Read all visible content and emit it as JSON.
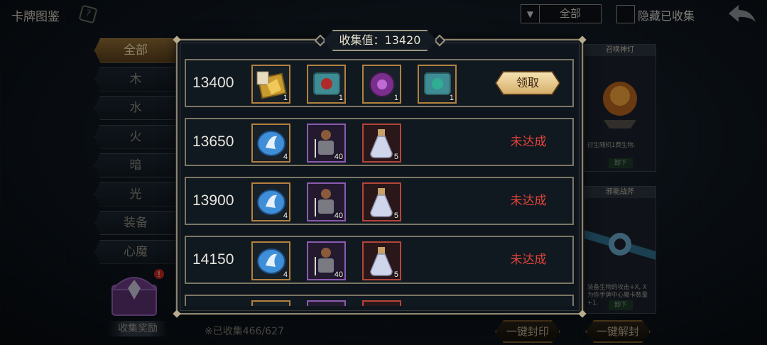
{
  "header": {
    "title": "卡牌图鉴",
    "filter_value": "全部",
    "hide_collected_label": "隐藏已收集"
  },
  "sidebar": {
    "categories": [
      "全部",
      "木",
      "水",
      "火",
      "暗",
      "光",
      "装备",
      "心魔"
    ],
    "collect_reward_label": "收集奖励"
  },
  "footer": {
    "collected_text": "※已收集466/627",
    "seal_all_label": "一键封印",
    "unseal_all_label": "一键解封"
  },
  "side_cards": [
    {
      "title": "召唤神灯",
      "text": "衍生随机1费生物.",
      "equip_label": "卸下"
    },
    {
      "title": "邪能战斧",
      "text": "装备生物的攻击+X, X为你手牌中心魔卡数量+1.",
      "equip_label": "卸下"
    }
  ],
  "modal": {
    "title": "收集值：13420",
    "claim_label": "领取",
    "not_achieved_label": "未达成",
    "milestones": [
      {
        "value": "13400",
        "status": "claimable",
        "rewards": [
          {
            "icon": "golden-card-pack-icon",
            "qty": "1"
          },
          {
            "icon": "red-rune-scroll-icon",
            "qty": "1"
          },
          {
            "icon": "purple-rune-orb-icon",
            "qty": "1"
          },
          {
            "icon": "teal-rune-scroll-icon",
            "qty": "1"
          }
        ]
      },
      {
        "value": "13650",
        "status": "locked",
        "rewards": [
          {
            "icon": "blue-crystal-icon",
            "qty": "4"
          },
          {
            "icon": "warrior-card-icon",
            "qty": "40"
          },
          {
            "icon": "potion-flask-icon",
            "qty": "5"
          }
        ]
      },
      {
        "value": "13900",
        "status": "locked",
        "rewards": [
          {
            "icon": "blue-crystal-icon",
            "qty": "4"
          },
          {
            "icon": "warrior-card-icon",
            "qty": "40"
          },
          {
            "icon": "potion-flask-icon",
            "qty": "5"
          }
        ]
      },
      {
        "value": "14150",
        "status": "locked",
        "rewards": [
          {
            "icon": "blue-crystal-icon",
            "qty": "4"
          },
          {
            "icon": "warrior-card-icon",
            "qty": "40"
          },
          {
            "icon": "potion-flask-icon",
            "qty": "5"
          }
        ]
      }
    ]
  },
  "colors": {
    "accent_gold": "#d6b06c",
    "not_achieved_red": "#e0453a",
    "frame": "#7c7663"
  }
}
